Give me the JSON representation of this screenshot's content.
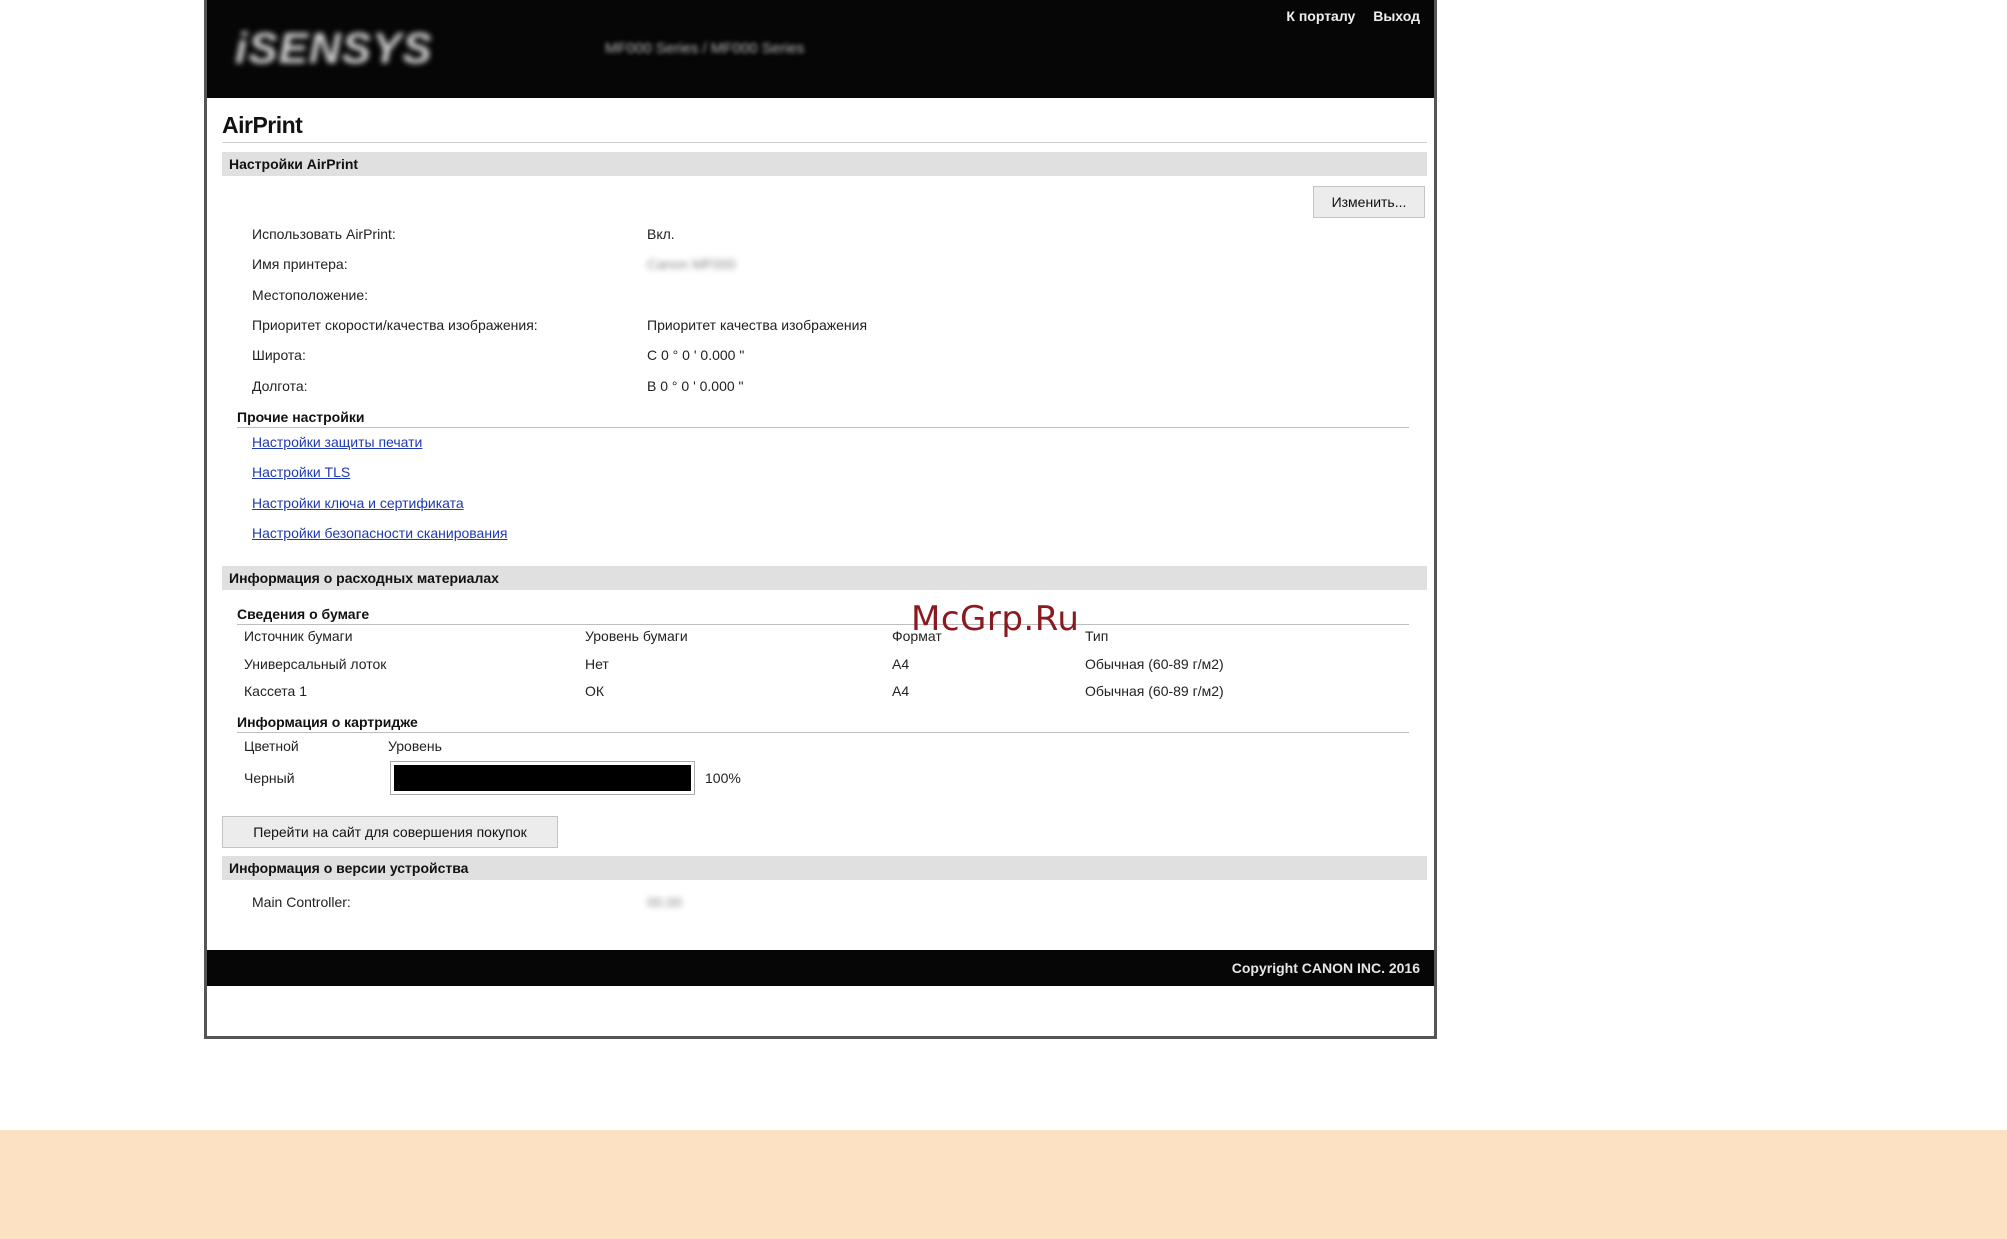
{
  "header": {
    "logo_text": "iSENSYS",
    "model_text": "MF000 Series / MF000 Series",
    "portal_link": "К порталу",
    "logout_link": "Выход"
  },
  "page_title": "AirPrint",
  "airprint_settings": {
    "section_title": "Настройки AirPrint",
    "edit_button": "Изменить...",
    "rows": [
      {
        "label": "Использовать AirPrint:",
        "value": "Вкл."
      },
      {
        "label": "Имя принтера:",
        "value": "Canon MF000"
      },
      {
        "label": "Местоположение:",
        "value": ""
      },
      {
        "label": "Приоритет скорости/качества изображения:",
        "value": "Приоритет качества изображения"
      },
      {
        "label": "Широта:",
        "value": "С 0 ° 0 ' 0.000 \""
      },
      {
        "label": "Долгота:",
        "value": "В 0 ° 0 ' 0.000 \""
      }
    ]
  },
  "other_settings": {
    "title": "Прочие настройки",
    "links": [
      "Настройки защиты печати",
      "Настройки TLS",
      "Настройки ключа и сертификата",
      "Настройки безопасности сканирования"
    ]
  },
  "consumables": {
    "section_title": "Информация о расходных материалах",
    "paper": {
      "title": "Сведения о бумаге",
      "headers": [
        "Источник бумаги",
        "Уровень бумаги",
        "Формат",
        "Тип"
      ],
      "rows": [
        [
          "Универсальный лоток",
          "Нет",
          "A4",
          "Обычная (60-89 г/м2)"
        ],
        [
          "Кассета 1",
          "ОК",
          "A4",
          "Обычная (60-89 г/м2)"
        ]
      ]
    },
    "cartridge": {
      "title": "Информация о картридже",
      "headers": [
        "Цветной",
        "Уровень"
      ],
      "color": "Черный",
      "level_percent": 100,
      "level_text": "100%"
    },
    "shop_button": "Перейти на сайт для совершения покупок"
  },
  "device_version": {
    "section_title": "Информация о версии устройства",
    "label": "Main Controller:",
    "value": "00.00"
  },
  "footer": {
    "copyright": "Copyright CANON INC. 2016"
  },
  "watermark": "McGrp.Ru",
  "colors": {
    "accent_link": "#203ab0",
    "header_bg": "#060606",
    "section_bg": "#e0e0e0",
    "bottom_band": "#fce2c3"
  }
}
